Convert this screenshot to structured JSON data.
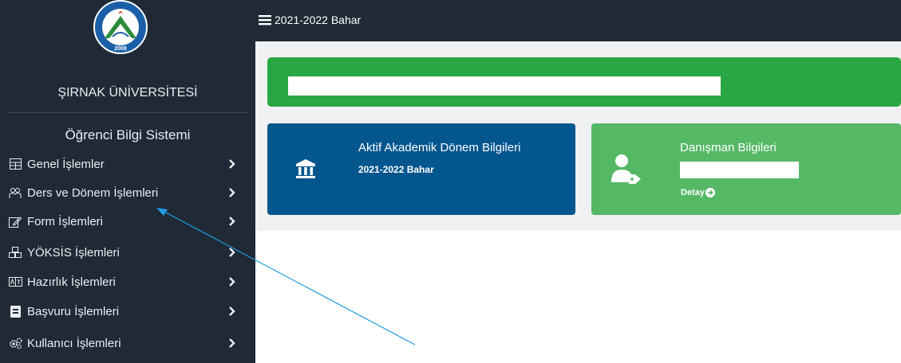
{
  "sidebar": {
    "university": "ŞIRNAK ÜNİVERSİTESİ",
    "system": "Öğrenci Bilgi Sistemi",
    "logo": {
      "top_text": "T.C. ŞIRNAK ÜNİVERSİTESİ",
      "year": "2008"
    },
    "items": [
      {
        "label": "Genel İşlemler",
        "icon": "layout-icon"
      },
      {
        "label": "Ders ve Dönem İşlemleri",
        "icon": "people-icon"
      },
      {
        "label": "Form İşlemleri",
        "icon": "edit-form-icon"
      },
      {
        "label": "YÖKSİS İşlemleri",
        "icon": "cubes-icon"
      },
      {
        "label": "Hazırlık İşlemleri",
        "icon": "language-icon"
      },
      {
        "label": "Başvuru İşlemleri",
        "icon": "id-card-icon"
      },
      {
        "label": "Kullanıcı İşlemleri",
        "icon": "gears-icon"
      }
    ]
  },
  "topbar": {
    "term": "2021-2022 Bahar"
  },
  "cards": {
    "academic": {
      "title": "Aktif Akademik Dönem Bilgileri",
      "value": "2021-2022 Bahar"
    },
    "advisor": {
      "title": "Danışman Bilgileri",
      "link": "Detay"
    }
  },
  "colors": {
    "sidebar_bg": "#1f2a36",
    "alert_green": "#28a744",
    "card_blue": "#04568e",
    "card_green": "#55b865",
    "arrow": "#1e9be0"
  }
}
